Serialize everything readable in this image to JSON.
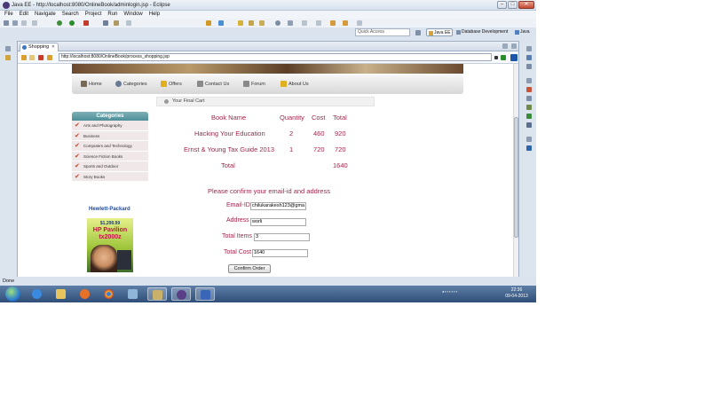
{
  "window": {
    "title": "Java EE - http://localhost:8080/OnlineBook/adminlogin.jsp - Eclipse"
  },
  "menu": [
    "File",
    "Edit",
    "Navigate",
    "Search",
    "Project",
    "Run",
    "Window",
    "Help"
  ],
  "toolbar": {
    "quick_access_placeholder": "Quick Access",
    "perspectives": [
      "Java EE",
      "Database Development",
      "Java"
    ]
  },
  "editor": {
    "tab_label": "Shopping",
    "url": "http://localhost:8080/OnlineBook/process_shopping.jsp"
  },
  "site": {
    "nav": [
      "Home",
      "Categories",
      "Offers",
      "Contact Us",
      "Forum",
      "About Us"
    ],
    "cart_heading": "Your Final Cart",
    "categories_title": "Categories",
    "categories": [
      "Arts and Photography",
      "Business",
      "Computers and Technology",
      "Science Fiction Books",
      "Sports and Outdoor",
      "Story Books"
    ],
    "ad": {
      "title": "Hewlett-Packard",
      "price": "$1,299.99",
      "line1": "HP Pavilion",
      "line2": "tx2000z"
    }
  },
  "cart": {
    "headers": [
      "Book Name",
      "Quantity",
      "Cost",
      "Total"
    ],
    "rows": [
      {
        "name": "Hacking Your Education",
        "qty": "2",
        "cost": "460",
        "total": "920"
      },
      {
        "name": "Ernst & Young Tax Guide 2013",
        "qty": "1",
        "cost": "720",
        "total": "720"
      }
    ],
    "total_label": "Total",
    "grand_total": "1640"
  },
  "form": {
    "prompt": "Please confirm your email-id and address",
    "email_label": "Email-ID",
    "email_value": "chilukarakesh123@gma",
    "address_label": "Address",
    "address_value": "worli",
    "items_label": "Total Items",
    "items_value": "3",
    "cost_label": "Total Cost",
    "cost_value": "1640",
    "confirm_button": "Confirm Order"
  },
  "status": {
    "text": "Done"
  },
  "taskbar": {
    "time": "22:36",
    "date": "09-04-2013"
  }
}
